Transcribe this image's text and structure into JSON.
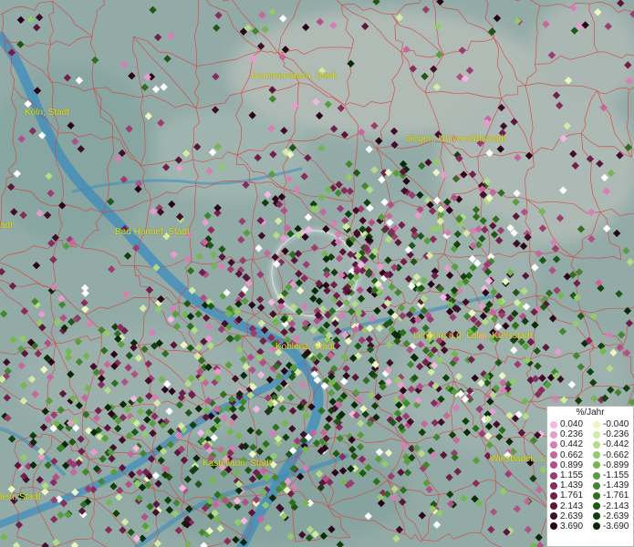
{
  "legend": {
    "title": "%/Jahr",
    "positive": [
      {
        "label": "0.040",
        "color": "#f2b8e2"
      },
      {
        "label": "0.236",
        "color": "#e89ccd"
      },
      {
        "label": "0.442",
        "color": "#d67fb4"
      },
      {
        "label": "0.662",
        "color": "#c7679d"
      },
      {
        "label": "0.899",
        "color": "#b24f86"
      },
      {
        "label": "1.155",
        "color": "#9c3c70"
      },
      {
        "label": "1.439",
        "color": "#872c5d"
      },
      {
        "label": "1.761",
        "color": "#71204c"
      },
      {
        "label": "2.143",
        "color": "#5a163b"
      },
      {
        "label": "2.639",
        "color": "#420d2b"
      },
      {
        "label": "3.690",
        "color": "#2a0519"
      }
    ],
    "negative": [
      {
        "label": "-0.040",
        "color": "#eef6c4"
      },
      {
        "label": "-0.236",
        "color": "#d3eba4"
      },
      {
        "label": "-0.442",
        "color": "#b4dc86"
      },
      {
        "label": "-0.662",
        "color": "#93cb6b"
      },
      {
        "label": "-0.899",
        "color": "#74b652"
      },
      {
        "label": "-1.155",
        "color": "#589e3e"
      },
      {
        "label": "-1.439",
        "color": "#42872e"
      },
      {
        "label": "-1.761",
        "color": "#2f6f21"
      },
      {
        "label": "-2.143",
        "color": "#1f5716"
      },
      {
        "label": "-2.639",
        "color": "#12400d"
      },
      {
        "label": "-3.690",
        "color": "#082a06"
      }
    ]
  },
  "cities": [
    {
      "id": "gummersbach",
      "name": "Gummersbach, Stadt"
    },
    {
      "id": "koeln",
      "name": "Köln, Stadt"
    },
    {
      "id": "siegen",
      "name": "Siegen, Universitätsstadt"
    },
    {
      "id": "bad-honnef",
      "name": "Bad Honnef, Stadt"
    },
    {
      "id": "edge-left",
      "name": "adt"
    },
    {
      "id": "koblenz",
      "name": "Koblenz, Stadt"
    },
    {
      "id": "limburg",
      "name": "Limburg a.d. Lahn, Kreisstadt"
    },
    {
      "id": "kastellaun",
      "name": "Kastellaun, Stadt"
    },
    {
      "id": "wiesbaden",
      "name": "Wiesbaden, L"
    },
    {
      "id": "bottom-left",
      "name": "lein, Stadt"
    }
  ],
  "colors": {
    "terrain": "#8fa6a2",
    "river": "#3d8fc0",
    "boundary": "#d7403c",
    "label": "#e8e21a",
    "focus_ring": "#ffffff"
  }
}
